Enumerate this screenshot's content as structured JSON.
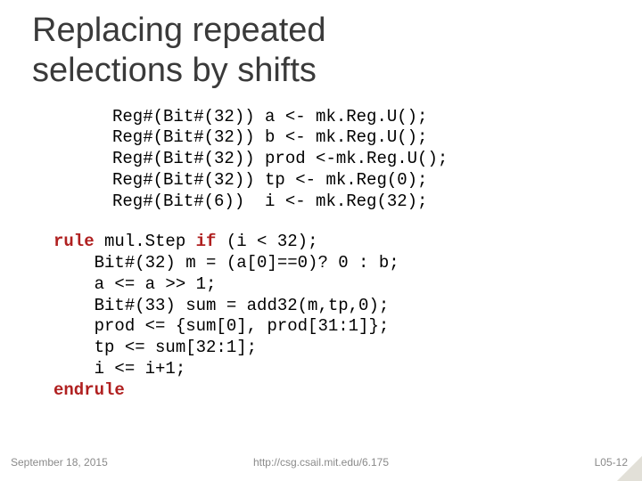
{
  "title_line1": "Replacing repeated",
  "title_line2": "selections by shifts",
  "decls": [
    "Reg#(Bit#(32)) a <- mk.Reg.U();",
    "Reg#(Bit#(32)) b <- mk.Reg.U();",
    "Reg#(Bit#(32)) prod <-mk.Reg.U();",
    "Reg#(Bit#(32)) tp <- mk.Reg(0);",
    "Reg#(Bit#(6))  i <- mk.Reg(32);"
  ],
  "rule": {
    "kw_rule": "rule",
    "rule_head": " mul.Step ",
    "kw_if": "if",
    "rule_cond": " (i < 32);",
    "body": [
      "    Bit#(32) m = (a[0]==0)? 0 : b;",
      "    a <= a >> 1;",
      "    Bit#(33) sum = add32(m,tp,0);",
      "    prod <= {sum[0], prod[31:1]};",
      "    tp <= sum[32:1];",
      "    i <= i+1;"
    ],
    "kw_endrule": "endrule"
  },
  "footer": {
    "date": "September 18, 2015",
    "url": "http://csg.csail.mit.edu/6.175",
    "page": "L05-12"
  }
}
